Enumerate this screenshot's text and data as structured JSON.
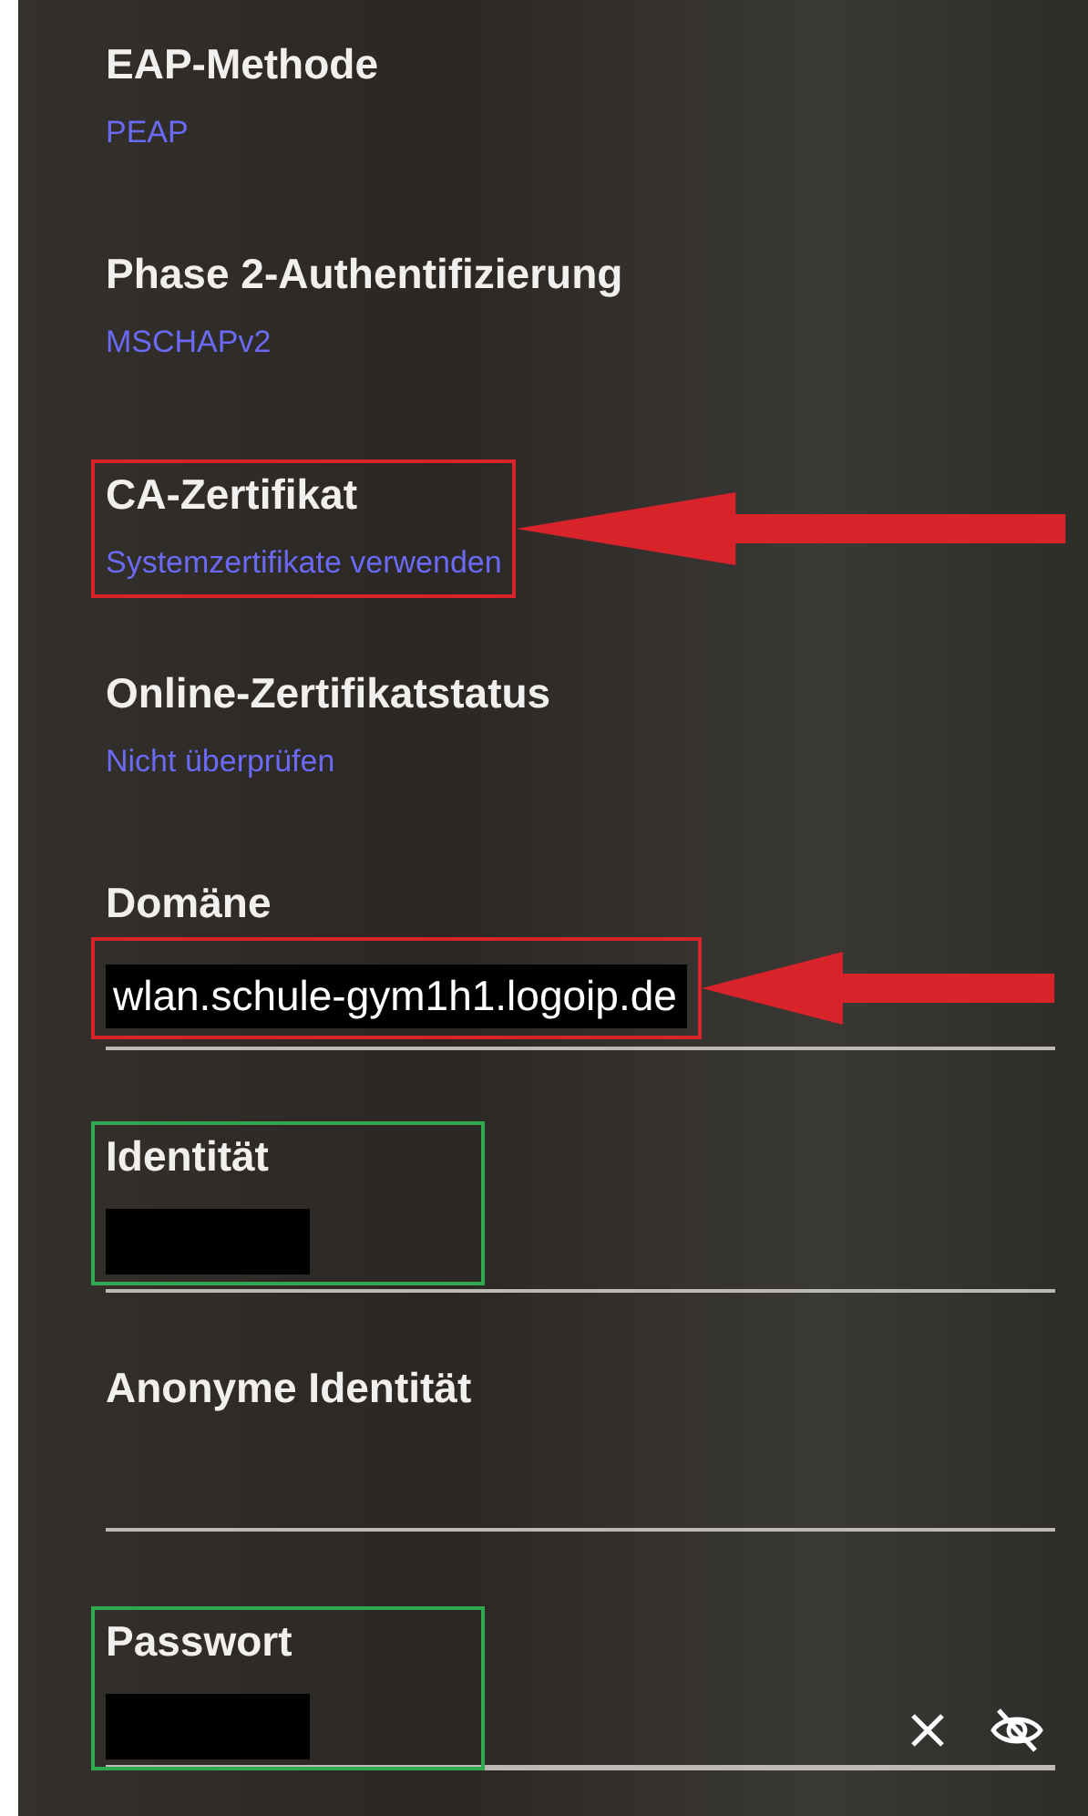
{
  "settings": [
    {
      "label": "EAP-Methode",
      "value": "PEAP"
    },
    {
      "label": "Phase 2-Authentifizierung",
      "value": "MSCHAPv2"
    },
    {
      "label": "CA-Zertifikat",
      "value": "Systemzertifikate verwenden",
      "highlight": {
        "color": "#d9232a",
        "arrow": true
      }
    },
    {
      "label": "Online-Zertifikatstatus",
      "value": "Nicht überprüfen"
    }
  ],
  "fields": [
    {
      "kind": "text",
      "label": "Domäne",
      "value": "wlan.schule-gym1h1.logoip.de",
      "highlight": {
        "color": "#d9232a",
        "arrow": true
      }
    },
    {
      "kind": "text",
      "label": "Identität",
      "redacted": true,
      "highlight": {
        "color": "#2fa84f",
        "arrow": false
      }
    },
    {
      "kind": "text",
      "label": "Anonyme Identität"
    },
    {
      "kind": "password",
      "label": "Passwort",
      "redacted": true,
      "highlight": {
        "color": "#2fa84f",
        "arrow": false
      }
    }
  ]
}
